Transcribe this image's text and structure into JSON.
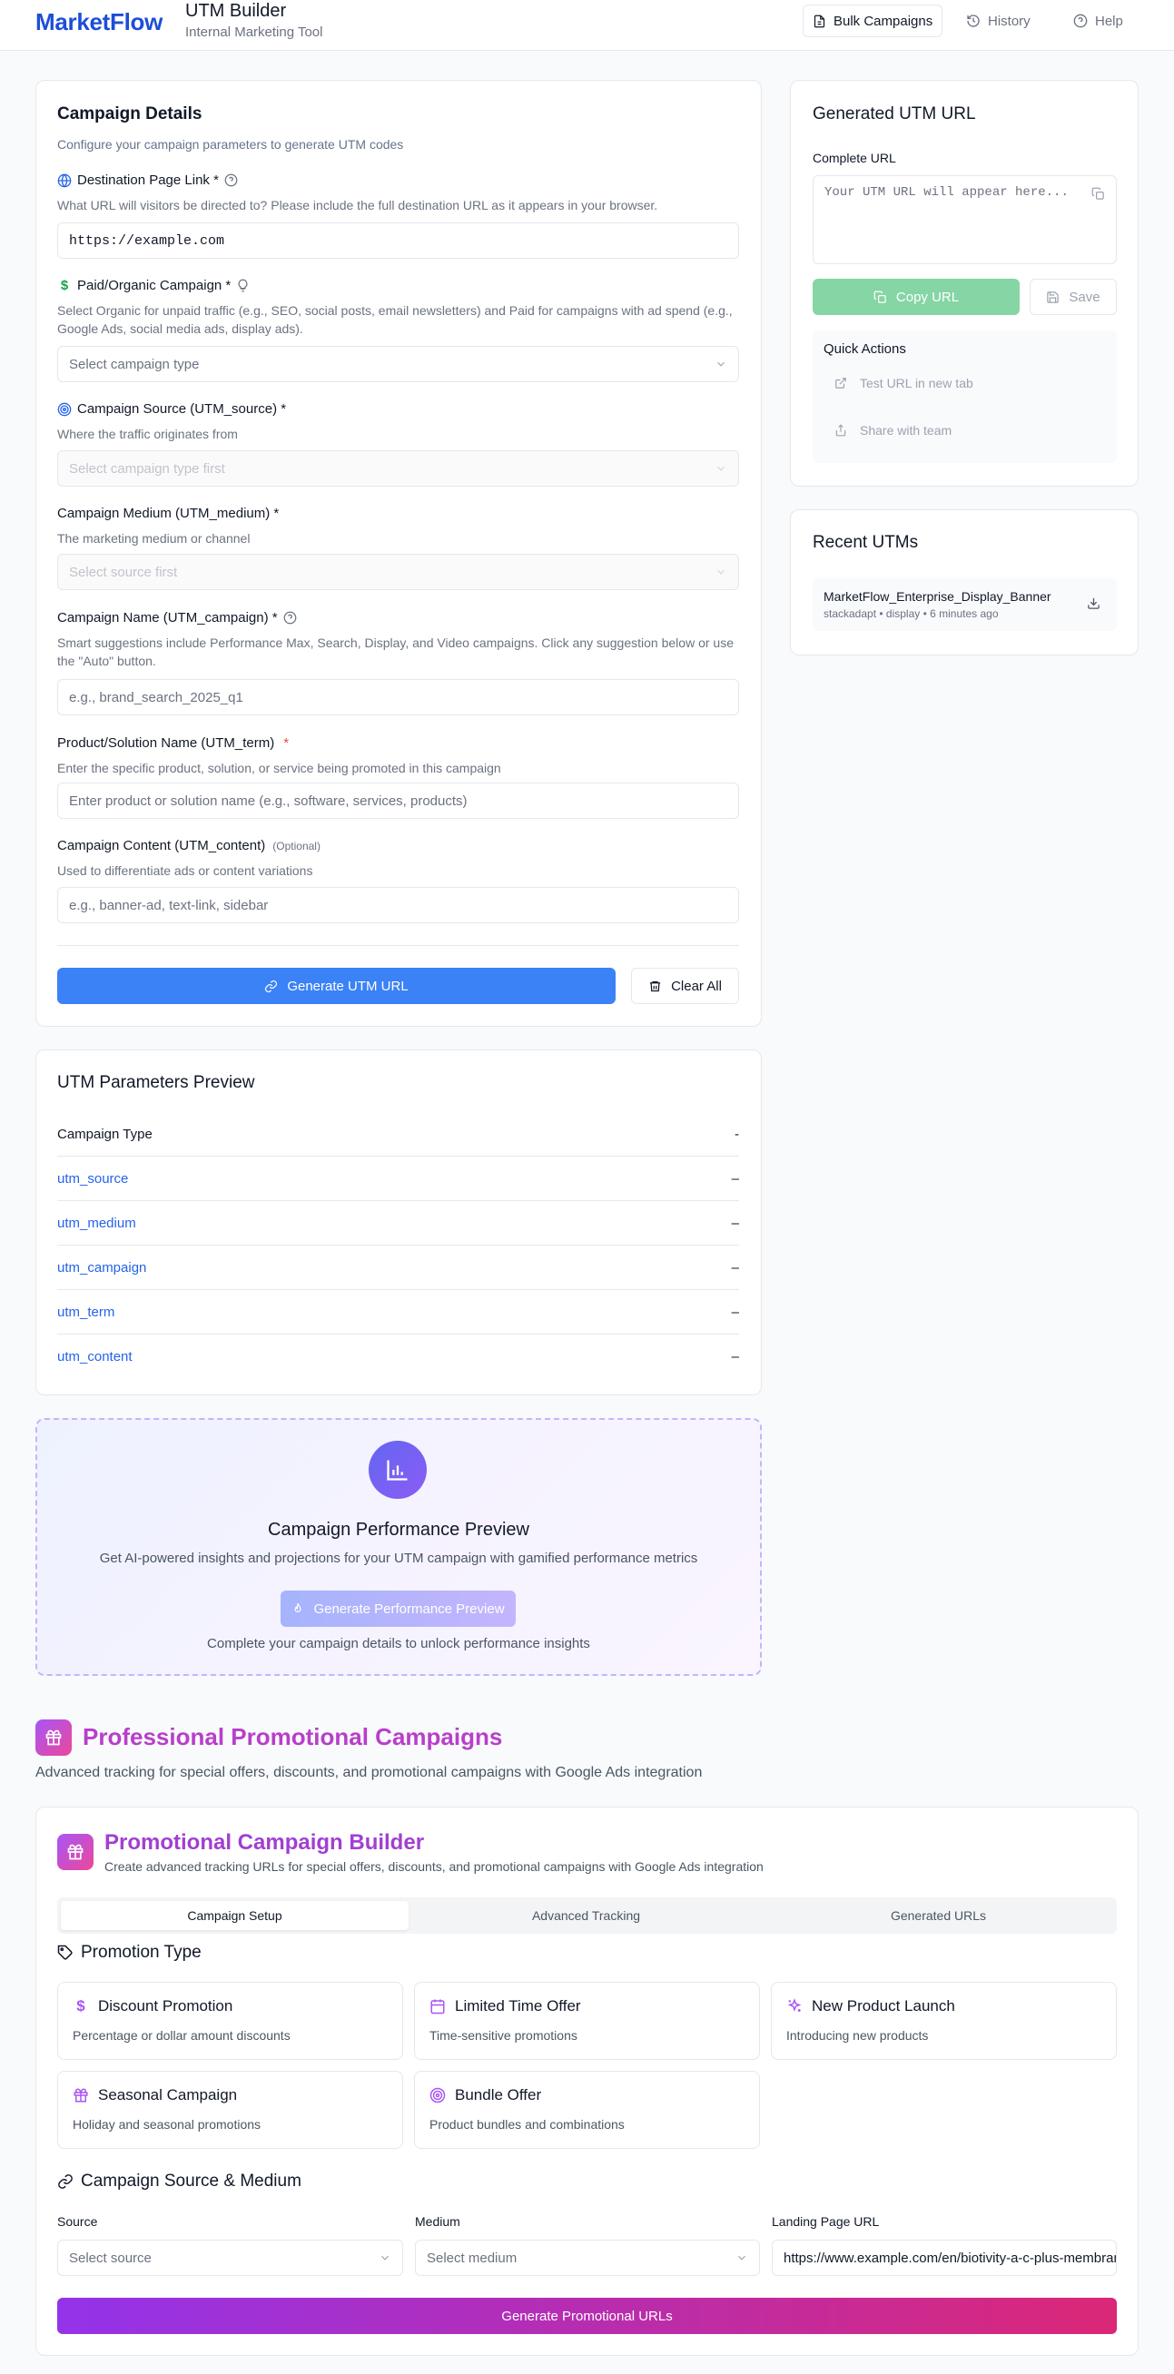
{
  "header": {
    "logo": "MarketFlow",
    "title": "UTM Builder",
    "subtitle": "Internal Marketing Tool",
    "bulk_label": "Bulk Campaigns",
    "history_label": "History",
    "help_label": "Help"
  },
  "details": {
    "title": "Campaign Details",
    "subtitle": "Configure your campaign parameters to generate UTM codes",
    "destination": {
      "label": "Destination Page Link *",
      "help": "What URL will visitors be directed to? Please include the full destination URL as it appears in your browser.",
      "value": "https://example.com"
    },
    "paid": {
      "label": "Paid/Organic Campaign *",
      "help": "Select Organic for unpaid traffic (e.g., SEO, social posts, email newsletters) and Paid for campaigns with ad spend (e.g., Google Ads, social media ads, display ads).",
      "placeholder": "Select campaign type"
    },
    "source": {
      "label": "Campaign Source (UTM_source) *",
      "help": "Where the traffic originates from",
      "placeholder": "Select campaign type first"
    },
    "medium": {
      "label": "Campaign Medium (UTM_medium) *",
      "help": "The marketing medium or channel",
      "placeholder": "Select source first"
    },
    "name": {
      "label": "Campaign Name (UTM_campaign) *",
      "help": "Smart suggestions include Performance Max, Search, Display, and Video campaigns. Click any suggestion below or use the \"Auto\" button.",
      "placeholder": "e.g., brand_search_2025_q1"
    },
    "term": {
      "label": "Product/Solution Name (UTM_term)",
      "required_mark": "*",
      "help": "Enter the specific product, solution, or service being promoted in this campaign",
      "placeholder": "Enter product or solution name (e.g., software, services, products)"
    },
    "content": {
      "label": "Campaign Content (UTM_content)",
      "optional": "(Optional)",
      "help": "Used to differentiate ads or content variations",
      "placeholder": "e.g., banner-ad, text-link, sidebar"
    },
    "generate_label": "Generate UTM URL",
    "clear_label": "Clear All"
  },
  "preview": {
    "title": "UTM Parameters Preview",
    "rows": [
      {
        "key": "Campaign Type",
        "value": "-"
      },
      {
        "key": "utm_source",
        "value": "–"
      },
      {
        "key": "utm_medium",
        "value": "–"
      },
      {
        "key": "utm_campaign",
        "value": "–"
      },
      {
        "key": "utm_term",
        "value": "–"
      },
      {
        "key": "utm_content",
        "value": "–"
      }
    ]
  },
  "performance": {
    "title": "Campaign Performance Preview",
    "subtitle": "Get AI-powered insights and projections for your UTM campaign with gamified performance metrics",
    "button_label": "Generate Performance Preview",
    "note": "Complete your campaign details to unlock performance insights"
  },
  "generated": {
    "title": "Generated UTM URL",
    "complete_label": "Complete URL",
    "placeholder": "Your UTM URL will appear here...",
    "copy_label": "Copy URL",
    "save_label": "Save",
    "quick_title": "Quick Actions",
    "test_label": "Test URL in new tab",
    "share_label": "Share with team"
  },
  "recent": {
    "title": "Recent UTMs",
    "items": [
      {
        "name": "MarketFlow_Enterprise_Display_Banner",
        "meta": "stackadapt • display • 6 minutes ago"
      }
    ]
  },
  "promo": {
    "heading": "Professional Promotional Campaigns",
    "subheading": "Advanced tracking for special offers, discounts, and promotional campaigns with Google Ads integration",
    "builder_title": "Promotional Campaign Builder",
    "builder_sub": "Create advanced tracking URLs for special offers, discounts, and promotional campaigns with Google Ads integration",
    "tabs": [
      "Campaign Setup",
      "Advanced Tracking",
      "Generated URLs"
    ],
    "type_heading": "Promotion Type",
    "types": [
      {
        "title": "Discount Promotion",
        "desc": "Percentage or dollar amount discounts"
      },
      {
        "title": "Limited Time Offer",
        "desc": "Time-sensitive promotions"
      },
      {
        "title": "New Product Launch",
        "desc": "Introducing new products"
      },
      {
        "title": "Seasonal Campaign",
        "desc": "Holiday and seasonal promotions"
      },
      {
        "title": "Bundle Offer",
        "desc": "Product bundles and combinations"
      }
    ],
    "sm_heading": "Campaign Source & Medium",
    "source_label": "Source",
    "source_placeholder": "Select source",
    "medium_label": "Medium",
    "medium_placeholder": "Select medium",
    "landing_label": "Landing Page URL",
    "landing_value": "https://www.example.com/en/biotivity-a-c-plus-membrane",
    "generate_label": "Generate Promotional URLs"
  },
  "colors": {
    "primary": "#3b82f6",
    "brand": "#1d4ed8",
    "promo_purple": "#9333ea",
    "promo_pink": "#db2777",
    "copy_green": "#86d5a5"
  }
}
